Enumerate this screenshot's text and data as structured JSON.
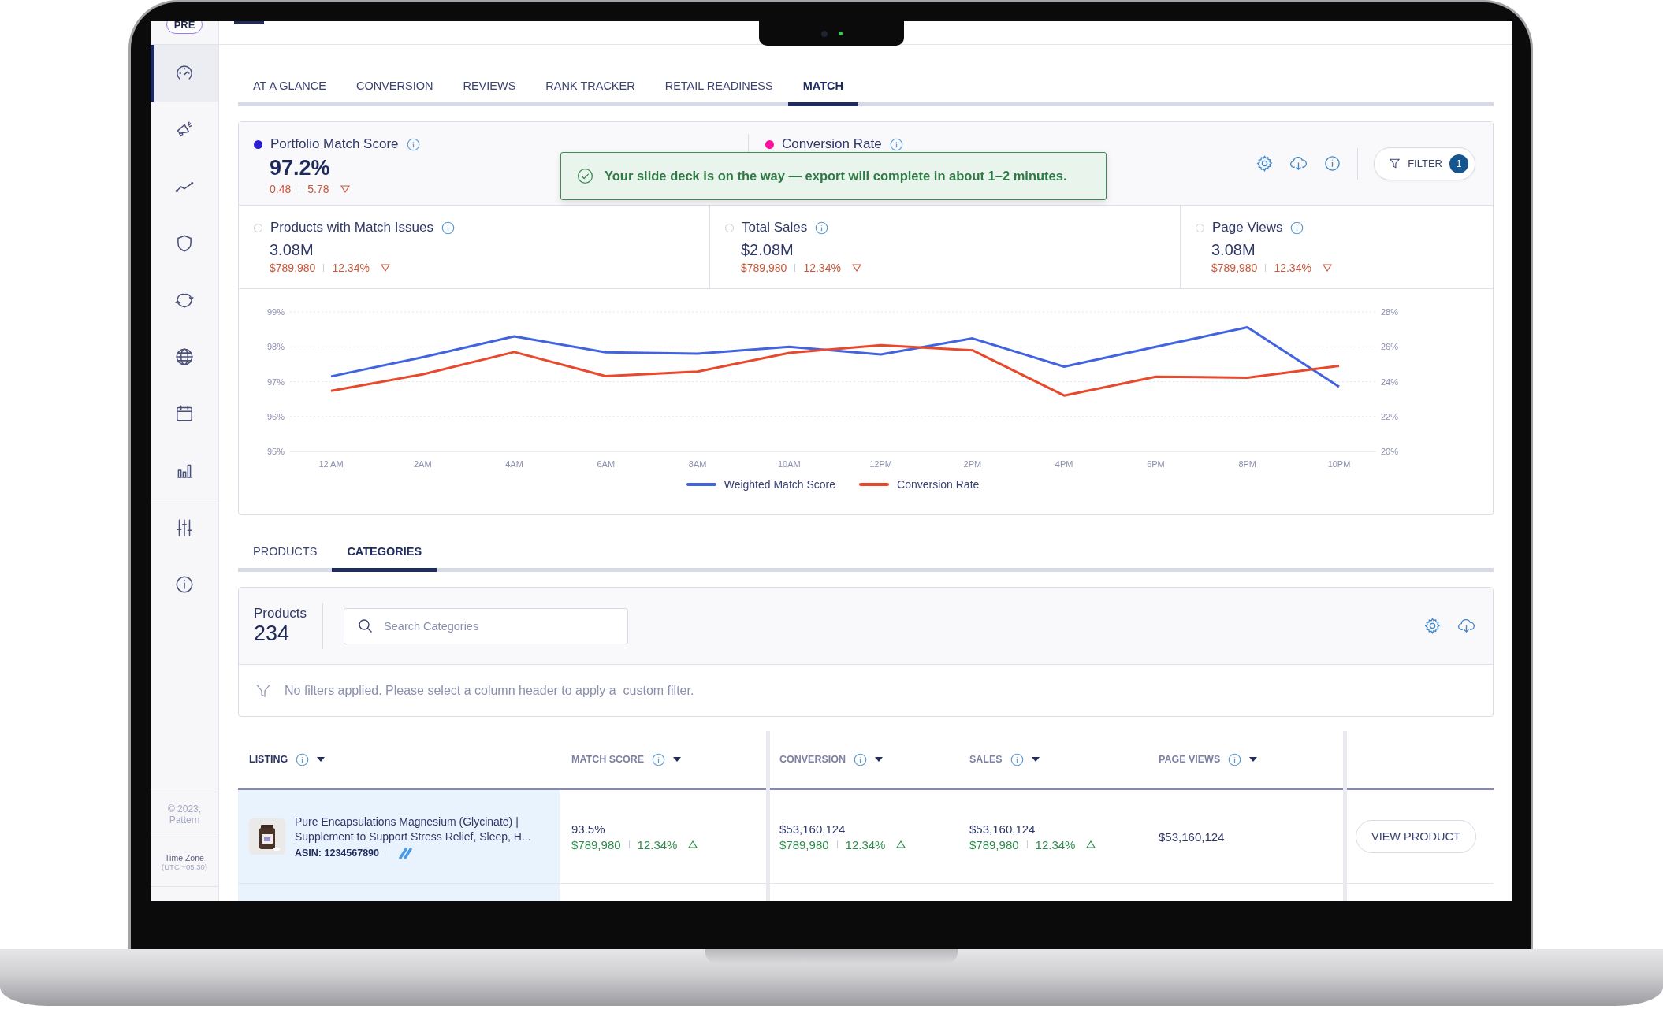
{
  "sidebar": {
    "badge": "PRE",
    "item_groups": [
      {
        "items": [
          {
            "kind": "gauge",
            "selected": true
          },
          {
            "kind": "megaphone",
            "selected": false
          },
          {
            "kind": "trend",
            "selected": false
          },
          {
            "kind": "shield",
            "selected": false
          },
          {
            "kind": "cycle",
            "selected": false
          },
          {
            "kind": "globe",
            "selected": false
          },
          {
            "kind": "calendar",
            "selected": false
          },
          {
            "kind": "bars",
            "selected": false
          }
        ]
      },
      {
        "items": [
          {
            "kind": "sliders",
            "selected": false
          },
          {
            "kind": "info",
            "selected": false
          }
        ]
      }
    ],
    "copyright": "© 2023, Pattern",
    "timezone_label": "Time Zone",
    "timezone": "(UTC +05:30)"
  },
  "tabs": [
    {
      "label": "AT A GLANCE",
      "selected": false
    },
    {
      "label": "CONVERSION",
      "selected": false
    },
    {
      "label": "REVIEWS",
      "selected": false
    },
    {
      "label": "RANK TRACKER",
      "selected": false
    },
    {
      "label": "RETAIL READINESS",
      "selected": false
    },
    {
      "label": "MATCH",
      "selected": true
    }
  ],
  "summary": {
    "metrics": [
      {
        "label": "Portfolio Match Score",
        "value": "97.2%",
        "change": "0.48",
        "change_pct": "5.78",
        "positive": false,
        "selected": true,
        "color": "#2a1fd6"
      },
      {
        "label": "Conversion Rate",
        "selected": true,
        "color": "#ff0f9b"
      }
    ],
    "filter": {
      "label": "FILTER",
      "count": "1"
    },
    "toast": {
      "text": "Your slide deck is on the way — export will complete in about 1–2 minutes."
    },
    "secondary_metrics": [
      {
        "label": "Products with Match Issues",
        "value": "3.08M",
        "change": "$789,980",
        "change_pct": "12.34%",
        "positive": false,
        "selected": false
      },
      {
        "label": "Total Sales",
        "value": "$2.08M",
        "change": "$789,980",
        "change_pct": "12.34%",
        "positive": false,
        "selected": false
      },
      {
        "label": "Page Views",
        "value": "3.08M",
        "change": "$789,980",
        "change_pct": "12.34%",
        "positive": false,
        "selected": false
      }
    ],
    "chart": {
      "chart_data": {
        "type": "line",
        "grid": true,
        "legend": "bottom",
        "categories": [
          "12 AM",
          "2AM",
          "4AM",
          "6AM",
          "8AM",
          "10AM",
          "12PM",
          "2PM",
          "4PM",
          "6PM",
          "8PM",
          "10PM"
        ],
        "ylim": [
          95,
          99
        ],
        "yticks": [
          {
            "value": 95,
            "label": "95%"
          },
          {
            "value": 96,
            "label": "96%"
          },
          {
            "value": 97,
            "label": "97%"
          },
          {
            "value": 98,
            "label": "98%"
          },
          {
            "value": 99,
            "label": "99%"
          }
        ],
        "y2lim": [
          20,
          28
        ],
        "y2ticks": [
          {
            "value": 20,
            "label": "20%"
          },
          {
            "value": 22,
            "label": "22%"
          },
          {
            "value": 24,
            "label": "24%"
          },
          {
            "value": 26,
            "label": "26%"
          },
          {
            "value": 28,
            "label": "28%"
          }
        ],
        "series": [
          {
            "name": "Weighted Match Score",
            "color": "#4263e0",
            "values": [
              97.15,
              97.7,
              98.3,
              97.84,
              97.8,
              98.0,
              97.78,
              98.24,
              97.43,
              98.0,
              98.56,
              96.85
            ]
          },
          {
            "name": "Conversion Rate",
            "color": "#e8492c",
            "axis": "y2",
            "values": [
              23.47,
              24.42,
              25.7,
              24.31,
              24.58,
              25.65,
              26.09,
              25.8,
              23.2,
              24.28,
              24.23,
              24.9
            ]
          }
        ]
      }
    }
  },
  "bottom_tabs": [
    {
      "label": "PRODUCTS",
      "selected": false
    },
    {
      "label": "CATEGORIES",
      "selected": true
    }
  ],
  "products_panel": {
    "label": "Products",
    "count": "234",
    "search": {
      "placeholder": "Search Categories"
    },
    "filter_message": "No filters applied. Please select a column header to apply a  custom filter."
  },
  "table": {
    "columns": [
      {
        "label": "LISTING",
        "selected": true
      },
      {
        "label": "MATCH SCORE",
        "selected": false
      },
      {
        "label": "CONVERSION",
        "selected": false
      },
      {
        "label": "SALES",
        "selected": false
      },
      {
        "label": "PAGE VIEWS",
        "selected": false
      }
    ],
    "rows": [
      {
        "cells": [
          {
            "title": "Pure Encapsulations Magnesium (Glycinate) | Supplement to Support Stress Relief, Sleep, H...",
            "asin": "ASIN: 1234567890"
          },
          {
            "value": "93.5%",
            "change": "$789,980",
            "change_pct": "12.34%",
            "positive": true
          },
          {
            "value": "$53,160,124",
            "change": "$789,980",
            "change_pct": "12.34%",
            "positive": true
          },
          {
            "value": "$53,160,124",
            "change": "$789,980",
            "change_pct": "12.34%",
            "positive": true
          },
          {
            "value": "$53,160,124"
          }
        ],
        "action": "VIEW PRODUCT"
      }
    ]
  }
}
